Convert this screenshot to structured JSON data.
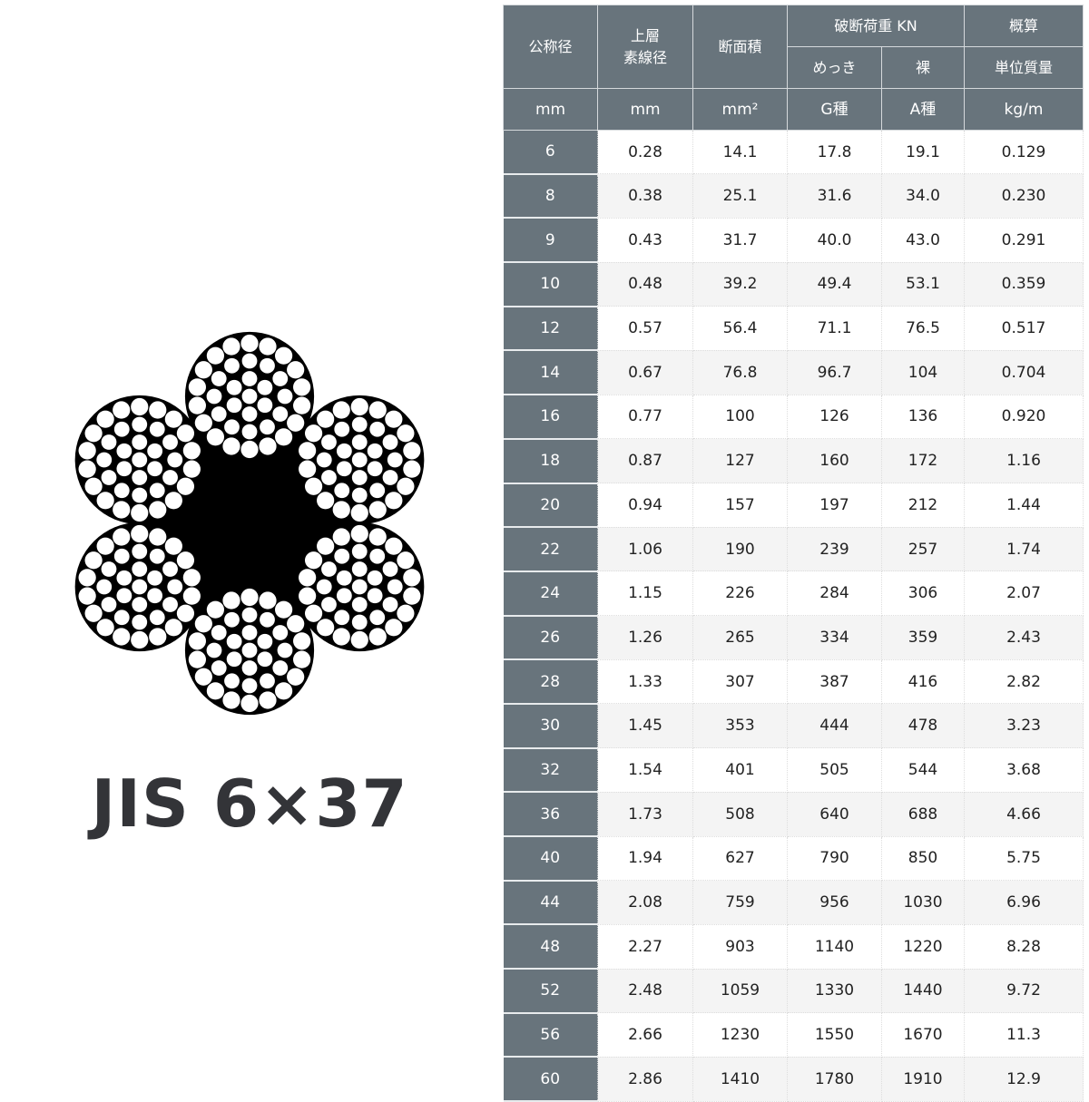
{
  "product": {
    "label": "JIS 6×37",
    "diagram": {
      "name": "wire-rope-cross-section",
      "strands": 6,
      "wires_per_strand": 37,
      "wire_layers": [
        1,
        6,
        12,
        18
      ],
      "core": "black-core"
    }
  },
  "table": {
    "headers": {
      "nominal_diameter": "公称径",
      "outer_wire_diameter_line1": "上層",
      "outer_wire_diameter_line2": "素線径",
      "cross_section": "断面積",
      "breaking_load": "破断荷重 KN",
      "galvanized": "めっき",
      "bare": "裸",
      "approx": "概算",
      "unit_mass": "単位質量"
    },
    "units": [
      "mm",
      "mm",
      "mm²",
      "G種",
      "A種",
      "kg/m"
    ],
    "rows": [
      [
        "6",
        "0.28",
        "14.1",
        "17.8",
        "19.1",
        "0.129"
      ],
      [
        "8",
        "0.38",
        "25.1",
        "31.6",
        "34.0",
        "0.230"
      ],
      [
        "9",
        "0.43",
        "31.7",
        "40.0",
        "43.0",
        "0.291"
      ],
      [
        "10",
        "0.48",
        "39.2",
        "49.4",
        "53.1",
        "0.359"
      ],
      [
        "12",
        "0.57",
        "56.4",
        "71.1",
        "76.5",
        "0.517"
      ],
      [
        "14",
        "0.67",
        "76.8",
        "96.7",
        "104",
        "0.704"
      ],
      [
        "16",
        "0.77",
        "100",
        "126",
        "136",
        "0.920"
      ],
      [
        "18",
        "0.87",
        "127",
        "160",
        "172",
        "1.16"
      ],
      [
        "20",
        "0.94",
        "157",
        "197",
        "212",
        "1.44"
      ],
      [
        "22",
        "1.06",
        "190",
        "239",
        "257",
        "1.74"
      ],
      [
        "24",
        "1.15",
        "226",
        "284",
        "306",
        "2.07"
      ],
      [
        "26",
        "1.26",
        "265",
        "334",
        "359",
        "2.43"
      ],
      [
        "28",
        "1.33",
        "307",
        "387",
        "416",
        "2.82"
      ],
      [
        "30",
        "1.45",
        "353",
        "444",
        "478",
        "3.23"
      ],
      [
        "32",
        "1.54",
        "401",
        "505",
        "544",
        "3.68"
      ],
      [
        "36",
        "1.73",
        "508",
        "640",
        "688",
        "4.66"
      ],
      [
        "40",
        "1.94",
        "627",
        "790",
        "850",
        "5.75"
      ],
      [
        "44",
        "2.08",
        "759",
        "956",
        "1030",
        "6.96"
      ],
      [
        "48",
        "2.27",
        "903",
        "1140",
        "1220",
        "8.28"
      ],
      [
        "52",
        "2.48",
        "1059",
        "1330",
        "1440",
        "9.72"
      ],
      [
        "56",
        "2.66",
        "1230",
        "1550",
        "1670",
        "11.3"
      ],
      [
        "60",
        "2.86",
        "1410",
        "1780",
        "1910",
        "12.9"
      ]
    ]
  },
  "colors": {
    "header_bg": "#68747c",
    "header_text": "#ffffff",
    "row_alt_bg": "#f4f4f4",
    "label_text": "#333438"
  }
}
